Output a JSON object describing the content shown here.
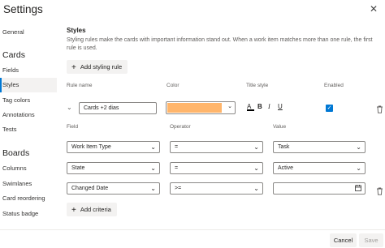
{
  "header": {
    "title": "Settings",
    "close_glyph": "✕"
  },
  "nav": {
    "general": "General",
    "cards_header": "Cards",
    "cards_items": [
      "Fields",
      "Styles",
      "Tag colors",
      "Annotations",
      "Tests"
    ],
    "boards_header": "Boards",
    "boards_items": [
      "Columns",
      "Swimlanes",
      "Card reordering",
      "Status badge"
    ],
    "selected": "Styles"
  },
  "styles": {
    "title": "Styles",
    "description": "Styling rules make the cards with important information stand out. When a work item matches more than one rule, the first rule is used.",
    "add_rule_label": "Add styling rule",
    "columns": {
      "rule_name": "Rule name",
      "color": "Color",
      "title_style": "Title style",
      "enabled": "Enabled"
    },
    "rule": {
      "name": "Cards +2 dias",
      "color": "#ffb56b",
      "title_style": {
        "color_glyph": "A",
        "bold": "B",
        "italic": "I",
        "underline": "U"
      },
      "enabled": true
    },
    "criteria_columns": {
      "field": "Field",
      "operator": "Operator",
      "value": "Value"
    },
    "criteria": [
      {
        "field": "Work Item Type",
        "operator": "=",
        "value": "Task"
      },
      {
        "field": "State",
        "operator": "=",
        "value": "Active"
      },
      {
        "field": "Changed Date",
        "operator": ">=",
        "value": ""
      }
    ],
    "add_criteria_label": "Add criteria"
  },
  "footer": {
    "cancel": "Cancel",
    "save": "Save"
  },
  "icons": {
    "close": "close-icon",
    "plus": "plus-icon",
    "chevron": "chevron-down-icon",
    "trash": "trash-icon",
    "calendar": "calendar-icon",
    "check": "check-icon"
  },
  "colors": {
    "accent": "#0078d4",
    "rule_color": "#ffb56b"
  }
}
